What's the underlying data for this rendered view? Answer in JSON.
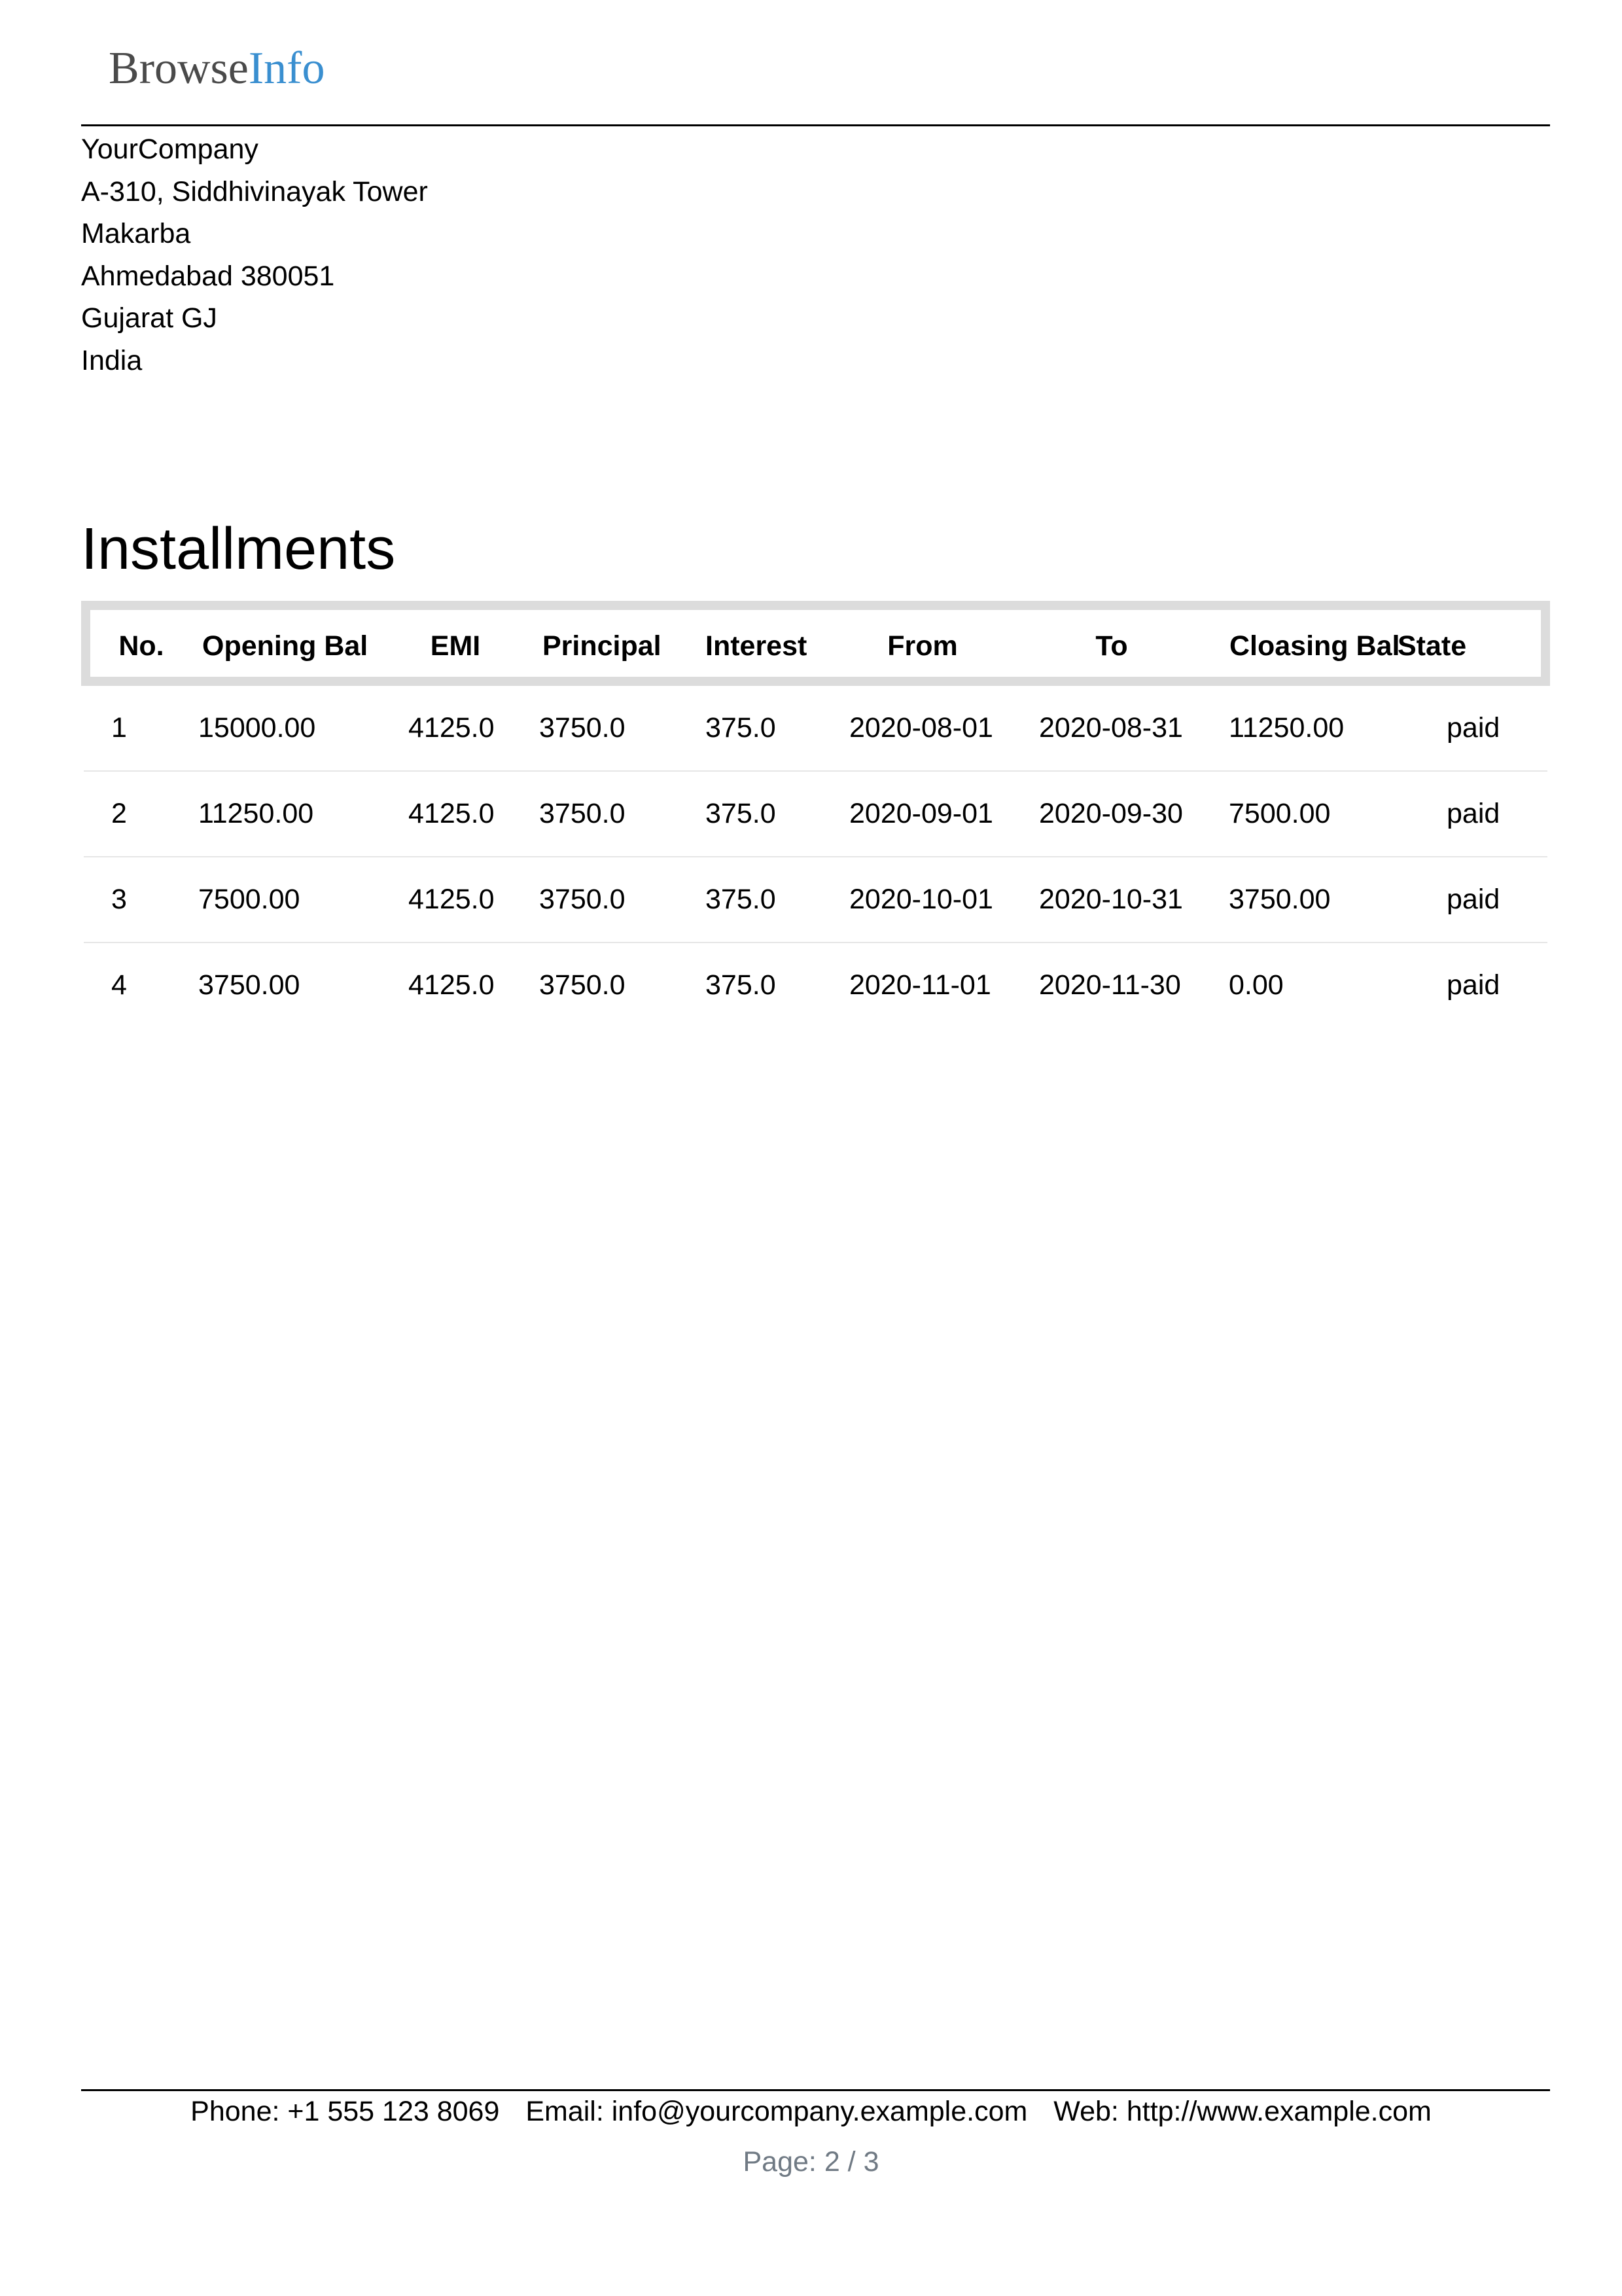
{
  "logo": {
    "part1": "Browse",
    "part2": "Info"
  },
  "company": {
    "name": "YourCompany",
    "address_lines": [
      "A-310, Siddhivinayak Tower",
      "Makarba",
      "Ahmedabad 380051",
      "Gujarat GJ",
      "India"
    ]
  },
  "title": "Installments",
  "table": {
    "headers": [
      "No.",
      "Opening Bal",
      "EMI",
      "Principal",
      "Interest",
      "From",
      "To",
      "Cloasing Bal",
      "State"
    ],
    "rows": [
      [
        "1",
        "15000.00",
        "4125.0",
        "3750.0",
        "375.0",
        "2020-08-01",
        "2020-08-31",
        "11250.00",
        "paid"
      ],
      [
        "2",
        "11250.00",
        "4125.0",
        "3750.0",
        "375.0",
        "2020-09-01",
        "2020-09-30",
        "7500.00",
        "paid"
      ],
      [
        "3",
        "7500.00",
        "4125.0",
        "3750.0",
        "375.0",
        "2020-10-01",
        "2020-10-31",
        "3750.00",
        "paid"
      ],
      [
        "4",
        "3750.00",
        "4125.0",
        "3750.0",
        "375.0",
        "2020-11-01",
        "2020-11-30",
        "0.00",
        "paid"
      ]
    ]
  },
  "footer": {
    "phone": "Phone: +1 555 123 8069",
    "email": "Email: info@yourcompany.example.com",
    "web": "Web: http://www.example.com",
    "page": "Page: 2 / 3"
  },
  "colors": {
    "logo_dark": "#4a4a4a",
    "logo_blue": "#3a8fd0",
    "header_border": "#dcdcdc",
    "page_number": "#707a84"
  }
}
